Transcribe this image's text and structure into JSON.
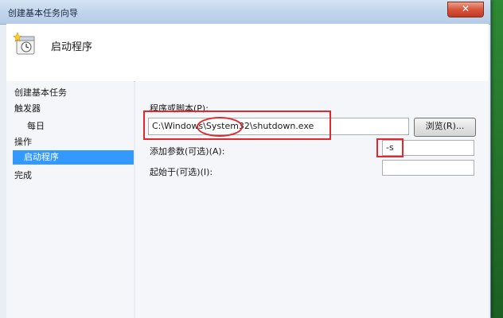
{
  "window": {
    "title": "创建基本任务向导",
    "close_glyph": "✕"
  },
  "header": {
    "title": "启动程序",
    "icon": "task-clock-icon"
  },
  "nav": {
    "items": [
      {
        "label": "创建基本任务"
      },
      {
        "label": "触发器"
      },
      {
        "label": "每日"
      },
      {
        "label": "操作"
      },
      {
        "label": "启动程序"
      },
      {
        "label": "完成"
      }
    ],
    "active_index": 4
  },
  "form": {
    "program_label": "程序或脚本(P):",
    "program_value": "C:\\Windows\\System32\\shutdown.exe",
    "browse_label": "浏览(R)...",
    "args_label": "添加参数(可选)(A):",
    "args_value": "-s",
    "start_in_label": "起始于(可选)(I):",
    "start_in_value": ""
  },
  "colors": {
    "highlight": "#3399ff",
    "annotation": "#e0292f"
  }
}
